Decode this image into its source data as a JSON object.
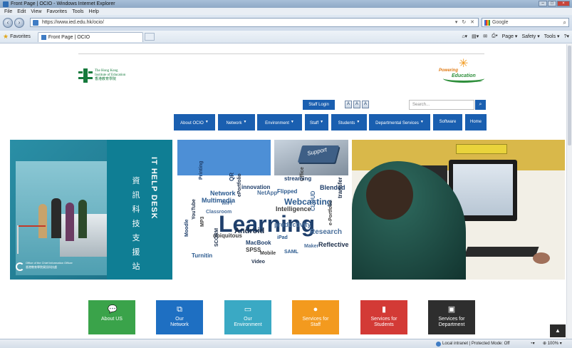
{
  "browser": {
    "window_title": "Front Page | OCIO - Windows Internet Explorer",
    "menu": [
      "File",
      "Edit",
      "View",
      "Favorites",
      "Tools",
      "Help"
    ],
    "address_url": "https://www.ied.edu.hk/ocio/",
    "search_engine": "Google",
    "favorites_label": "Favorites",
    "tab_title": "Front Page | OCIO",
    "command_bar": [
      "Page ▾",
      "Safety ▾",
      "Tools ▾"
    ],
    "status_zone": "Local intranet | Protected Mode: Off",
    "zoom": "100%"
  },
  "header": {
    "ied_logo_lines": [
      "The Hong Kong",
      "Institute of Education",
      "香港教育學院"
    ],
    "pe_logo": {
      "line1": "Powering",
      "line2": "Education",
      "line3": "Innovation"
    },
    "staff_login": "Staff Login",
    "font_size_buttons": [
      "A",
      "A",
      "A"
    ],
    "search_placeholder": "Search...",
    "search_button_icon": "search-icon"
  },
  "nav": [
    {
      "label": "About OCIO",
      "dropdown": true
    },
    {
      "label": "Network",
      "dropdown": true
    },
    {
      "label": "Environment",
      "dropdown": true
    },
    {
      "label": "Staff",
      "dropdown": true
    },
    {
      "label": "Students",
      "dropdown": true
    },
    {
      "label": "Departmental Services",
      "dropdown": true
    },
    {
      "label": "Software",
      "dropdown": false
    },
    {
      "label": "Home",
      "dropdown": false
    }
  ],
  "banner": {
    "helpdesk_en": "IT HELP DESK",
    "helpdesk_zh": [
      "資",
      "訊",
      "科",
      "技",
      "支",
      "援",
      "站"
    ],
    "office_en": "Office of the Chief Information Officer",
    "office_zh": "香港教育學院資訊科技處",
    "key_label": "Support",
    "word_cloud": [
      "Learning",
      "Webcasting",
      "Intelligence",
      "productivity",
      "Android",
      "MacBook",
      "Multimedia",
      "ubiquitous",
      "Research",
      "Reflective",
      "Blended",
      "Flipped",
      "SPSS",
      "CLOUD",
      "YouTube",
      "Moodle",
      "iPad",
      "Office",
      "NetApp",
      "transfer",
      "streaming",
      "Network",
      "e-Portfolio",
      "Classroom",
      "SCORM",
      "innovation",
      "Turnitin",
      "Mobile",
      "WiFi",
      "ePortfolio",
      "QR",
      "SAML",
      "MP3",
      "Maker",
      "Video",
      "Printing"
    ]
  },
  "quick_links": [
    {
      "label": "About US",
      "icon": "chat-icon",
      "color": "#3aa34a"
    },
    {
      "label": "Our\nNetwork",
      "icon": "network-icon",
      "color": "#1e6fc2"
    },
    {
      "label": "Our\nEnvironment",
      "icon": "monitor-icon",
      "color": "#3aa9c4"
    },
    {
      "label": "Services for\nStaff",
      "icon": "user-icon",
      "color": "#f39a1e"
    },
    {
      "label": "Services for\nStudents",
      "icon": "book-icon",
      "color": "#d33a36"
    },
    {
      "label": "Services for\nDepartment",
      "icon": "briefcase-icon",
      "color": "#2e2e2e"
    }
  ],
  "back_to_top_icon": "arrow-up-icon"
}
